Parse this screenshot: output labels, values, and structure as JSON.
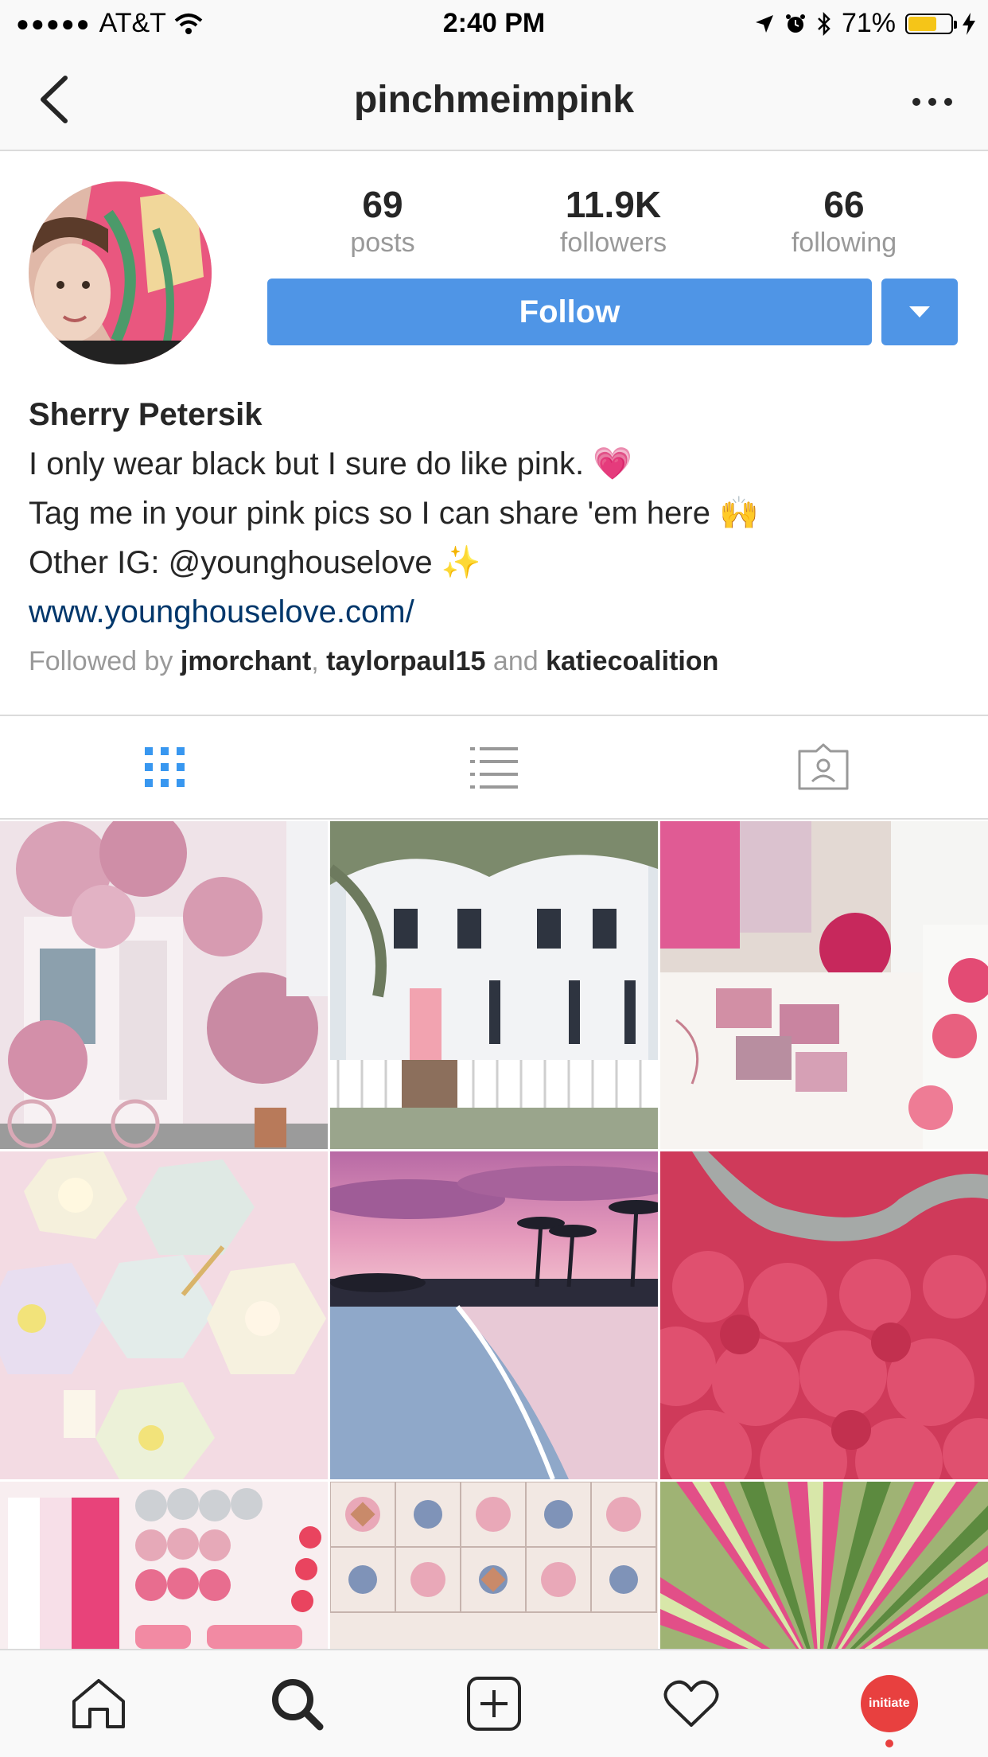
{
  "status": {
    "carrier": "AT&T",
    "time": "2:40 PM",
    "battery": "71%",
    "battery_level": 0.71,
    "signal_dots": "●●●●●"
  },
  "nav": {
    "title": "pinchmeimpink"
  },
  "profile": {
    "stats": [
      {
        "value": "69",
        "label": "posts"
      },
      {
        "value": "11.9K",
        "label": "followers"
      },
      {
        "value": "66",
        "label": "following"
      }
    ],
    "follow_label": "Follow",
    "name": "Sherry Petersik",
    "bio_lines": [
      "I only wear black but I sure do like pink. 💗",
      "Tag me in your pink pics so I can share 'em here 🙌",
      "Other IG: @younghouselove ✨"
    ],
    "website": "www.younghouselove.com/",
    "followed_by": {
      "prefix": "Followed by",
      "users": [
        "jmorchant",
        "taylorpaul15",
        "katiecoalition"
      ],
      "separator": ",",
      "conjunction": "and"
    }
  },
  "tabs": [
    {
      "icon": "grid-icon",
      "active": true
    },
    {
      "icon": "list-icon",
      "active": false
    },
    {
      "icon": "tagged-icon",
      "active": false
    }
  ],
  "grid_posts": [
    {
      "subject": "pink flower storefront",
      "colors": [
        "#f3d5df",
        "#c98aa3"
      ]
    },
    {
      "subject": "white house with pink door",
      "colors": [
        "#e9ecef",
        "#9aa58c"
      ]
    },
    {
      "subject": "pink stationery and stamps",
      "colors": [
        "#efe6e3",
        "#d96a8c"
      ]
    },
    {
      "subject": "pastel party plates",
      "colors": [
        "#f6dfe7",
        "#efe3b8"
      ]
    },
    {
      "subject": "pink sunset beach",
      "colors": [
        "#c37aa8",
        "#8fb0d4"
      ]
    },
    {
      "subject": "red kochia bushes",
      "colors": [
        "#d6415f",
        "#c9314f"
      ]
    },
    {
      "subject": "pink candy and chocolates",
      "colors": [
        "#f7e1e6",
        "#e8557d"
      ]
    },
    {
      "subject": "patterned tiles",
      "colors": [
        "#f0e4df",
        "#8d9bb7"
      ]
    },
    {
      "subject": "pink striped succulent",
      "colors": [
        "#c9d9a0",
        "#d94f86"
      ]
    }
  ],
  "bottom_nav": {
    "profile_thumb_text": "initiate"
  },
  "colors": {
    "accent": "#4f95e6",
    "link": "#00376b",
    "muted": "#999999",
    "border": "#dbdbdb",
    "active_tab": "#3897f0"
  }
}
